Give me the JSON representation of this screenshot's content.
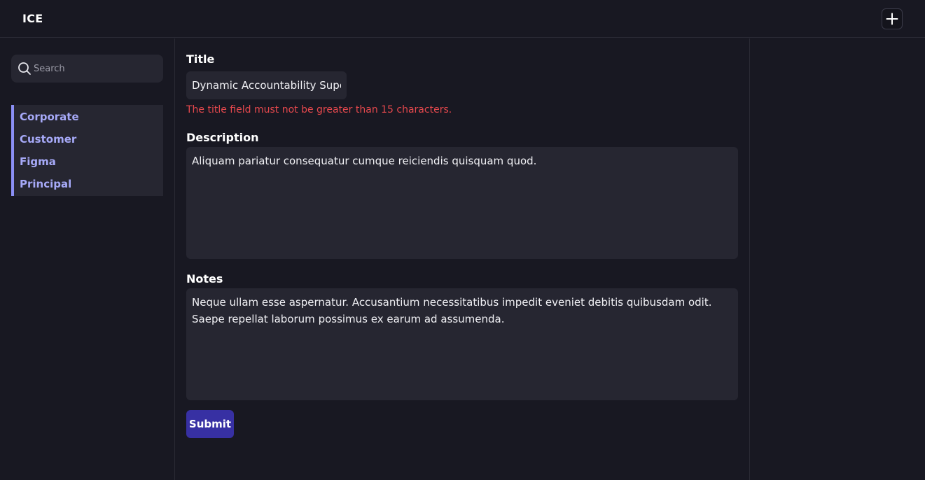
{
  "header": {
    "app_title": "ICE",
    "add_icon": "plus-icon"
  },
  "sidebar": {
    "search": {
      "placeholder": "Search",
      "value": "",
      "icon": "search-icon"
    },
    "items": [
      {
        "label": "Corporate"
      },
      {
        "label": "Customer"
      },
      {
        "label": "Figma"
      },
      {
        "label": "Principal"
      }
    ]
  },
  "form": {
    "title_label": "Title",
    "title_value": "Dynamic Accountability Supervisor",
    "title_error": "The title field must not be greater than 15 characters.",
    "description_label": "Description",
    "description_value": "Aliquam pariatur consequatur cumque reiciendis quisquam quod.",
    "notes_label": "Notes",
    "notes_value": "Neque ullam esse aspernatur. Accusantium necessitatibus impedit eveniet debitis quibusdam odit. Saepe repellat laborum possimus ex earum ad assumenda.",
    "submit_label": "Submit"
  },
  "colors": {
    "background": "#181822",
    "field_background": "#262631",
    "accent": "#8b8ff5",
    "error": "#e5484d",
    "button": "#3730a3"
  }
}
